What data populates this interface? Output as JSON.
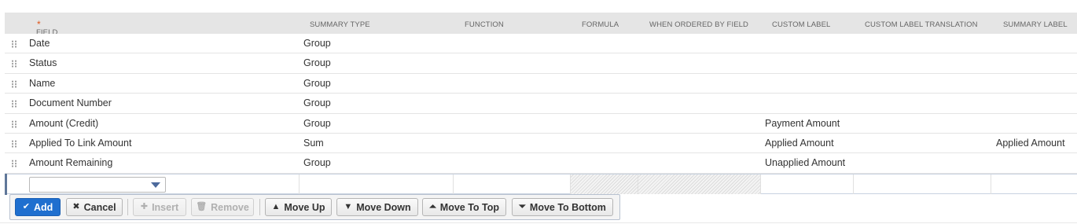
{
  "columns": {
    "field": "FIELD",
    "summary_type": "SUMMARY TYPE",
    "function": "FUNCTION",
    "formula": "FORMULA",
    "when_ordered_by_field": "WHEN ORDERED BY FIELD",
    "custom_label": "CUSTOM LABEL",
    "custom_label_translation": "CUSTOM LABEL TRANSLATION",
    "summary_label": "SUMMARY LABEL"
  },
  "required_marker": "*",
  "rows": [
    {
      "field": "Date",
      "summary_type": "Group",
      "custom_label": "",
      "summary_label": ""
    },
    {
      "field": "Status",
      "summary_type": "Group",
      "custom_label": "",
      "summary_label": ""
    },
    {
      "field": "Name",
      "summary_type": "Group",
      "custom_label": "",
      "summary_label": ""
    },
    {
      "field": "Document Number",
      "summary_type": "Group",
      "custom_label": "",
      "summary_label": ""
    },
    {
      "field": "Amount (Credit)",
      "summary_type": "Group",
      "custom_label": "Payment Amount",
      "summary_label": ""
    },
    {
      "field": "Applied To Link Amount",
      "summary_type": "Sum",
      "custom_label": "Applied Amount",
      "summary_label": "Applied Amount"
    },
    {
      "field": "Amount Remaining",
      "summary_type": "Group",
      "custom_label": "Unapplied Amount",
      "summary_label": ""
    }
  ],
  "toolbar": {
    "add": "Add",
    "cancel": "Cancel",
    "insert": "Insert",
    "remove": "Remove",
    "move_up": "Move Up",
    "move_down": "Move Down",
    "move_to_top": "Move To Top",
    "move_to_bottom": "Move To Bottom"
  },
  "icons": {
    "add": "check-icon",
    "cancel": "x-icon",
    "insert": "plus-icon",
    "remove": "trash-icon",
    "move_up": "triangle-up-icon",
    "move_down": "triangle-down-icon",
    "move_to_top": "bar-triangle-up-icon",
    "move_to_bottom": "bar-triangle-down-icon"
  },
  "colors": {
    "primary_button": "#1f6fcf",
    "required_star": "#e0581e",
    "header_bg": "#e5e5e5",
    "edit_row_accent": "#607799"
  }
}
